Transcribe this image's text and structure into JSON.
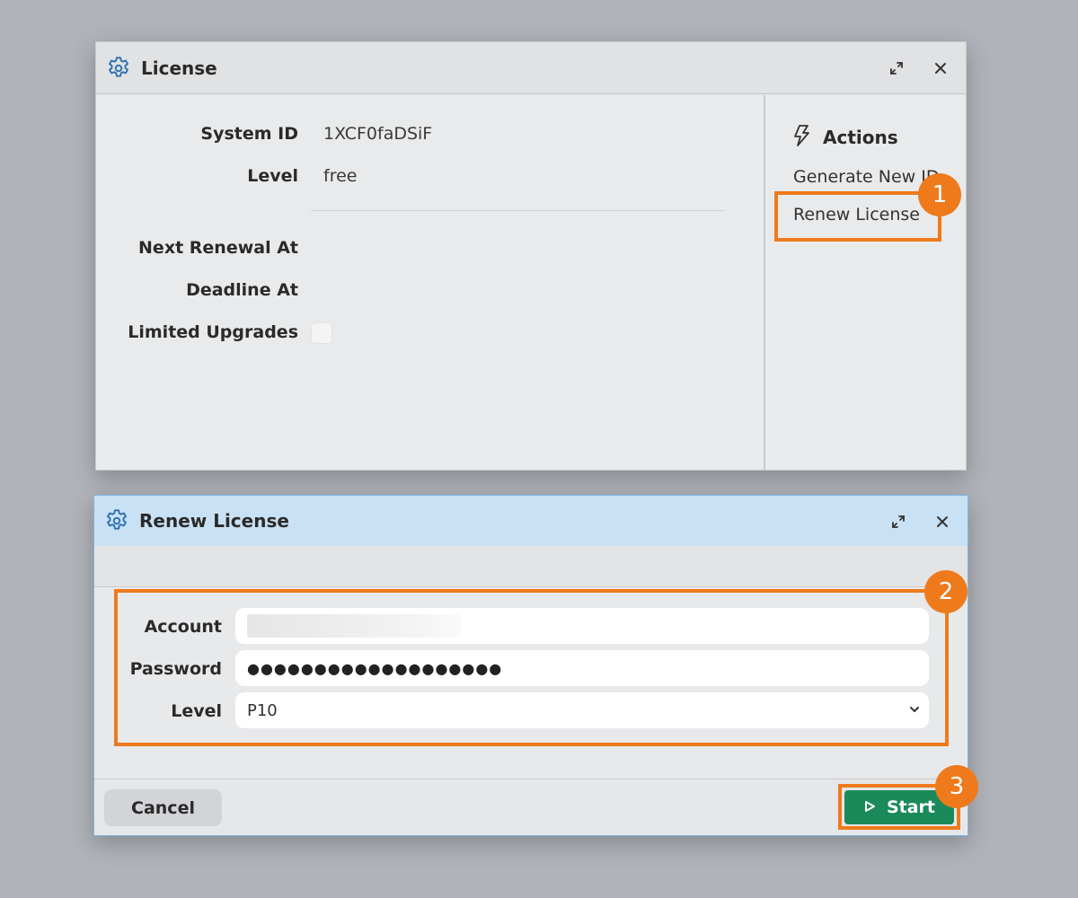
{
  "license_window": {
    "title": "License",
    "fields": [
      {
        "label": "System ID",
        "value": "1XCF0faDSiF"
      },
      {
        "label": "Level",
        "value": "free"
      },
      {
        "label": "Next Renewal At",
        "value": ""
      },
      {
        "label": "Deadline At",
        "value": ""
      },
      {
        "label": "Limited Upgrades",
        "checked": false
      }
    ],
    "actions": {
      "heading": "Actions",
      "items": [
        "Generate New ID",
        "Renew License"
      ]
    }
  },
  "renew_dialog": {
    "title": "Renew License",
    "account": {
      "label": "Account",
      "value": ""
    },
    "password": {
      "label": "Password",
      "value": "●●●●●●●●●●●●●●●●●●●"
    },
    "level": {
      "label": "Level",
      "value": "P10"
    },
    "cancel_label": "Cancel",
    "start_label": "Start"
  },
  "annotations": [
    "1",
    "2",
    "3"
  ],
  "colors": {
    "background": "#b0b3b9",
    "highlight": "#ee7a1c",
    "start_button": "#1b8a5a",
    "dialog_titlebar": "#c9e1f4",
    "gear_icon": "#2c6fb3"
  },
  "icons": {
    "window": "gear-icon",
    "restore": "restore-icon",
    "close": "close-icon",
    "actions": "lightning-icon",
    "select": "chevron-down-icon",
    "start": "play-icon"
  }
}
